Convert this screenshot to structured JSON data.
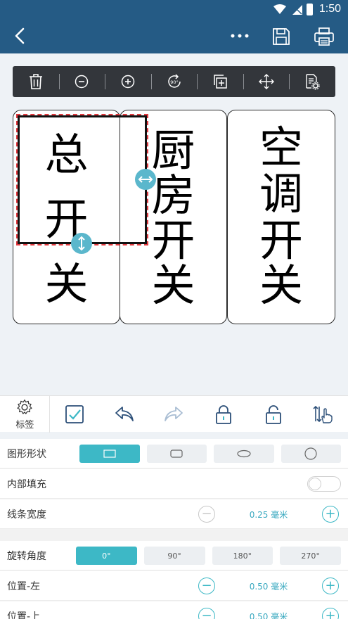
{
  "status_bar": {
    "time": "1:50"
  },
  "toolbar": {
    "icons": [
      "delete-icon",
      "zoom-out-icon",
      "zoom-in-icon",
      "rotate-90-icon",
      "duplicate-icon",
      "move-icon",
      "settings-doc-icon"
    ]
  },
  "label": {
    "cells": [
      {
        "line1": "总",
        "line2": "开",
        "line3": "关"
      },
      {
        "line1": "厨",
        "line2": "房",
        "line3": "开",
        "line4": "关"
      },
      {
        "line1": "空",
        "line2": "调",
        "line3": "开",
        "line4": "关"
      }
    ]
  },
  "bottom_tools": {
    "label_settings": "标签"
  },
  "panel": {
    "shape": {
      "label": "图形形状",
      "options": [
        "rectangle",
        "rounded-rectangle",
        "ellipse",
        "circle"
      ],
      "selected": "rectangle"
    },
    "fill": {
      "label": "内部填充",
      "on": false
    },
    "line_width": {
      "label": "线条宽度",
      "value": "0.25 毫米"
    },
    "rotation": {
      "label": "旋转角度",
      "options": [
        "0°",
        "90°",
        "180°",
        "270°"
      ],
      "selected": "0°"
    },
    "pos_left": {
      "label": "位置-左",
      "value": "0.50 毫米"
    },
    "pos_top": {
      "label": "位置-上",
      "value": "0.50 毫米"
    }
  },
  "colors": {
    "primary": "#255b85",
    "accent": "#3db8c6",
    "toolbar_bg": "#33363b",
    "selection_dash": "#e0393e"
  }
}
